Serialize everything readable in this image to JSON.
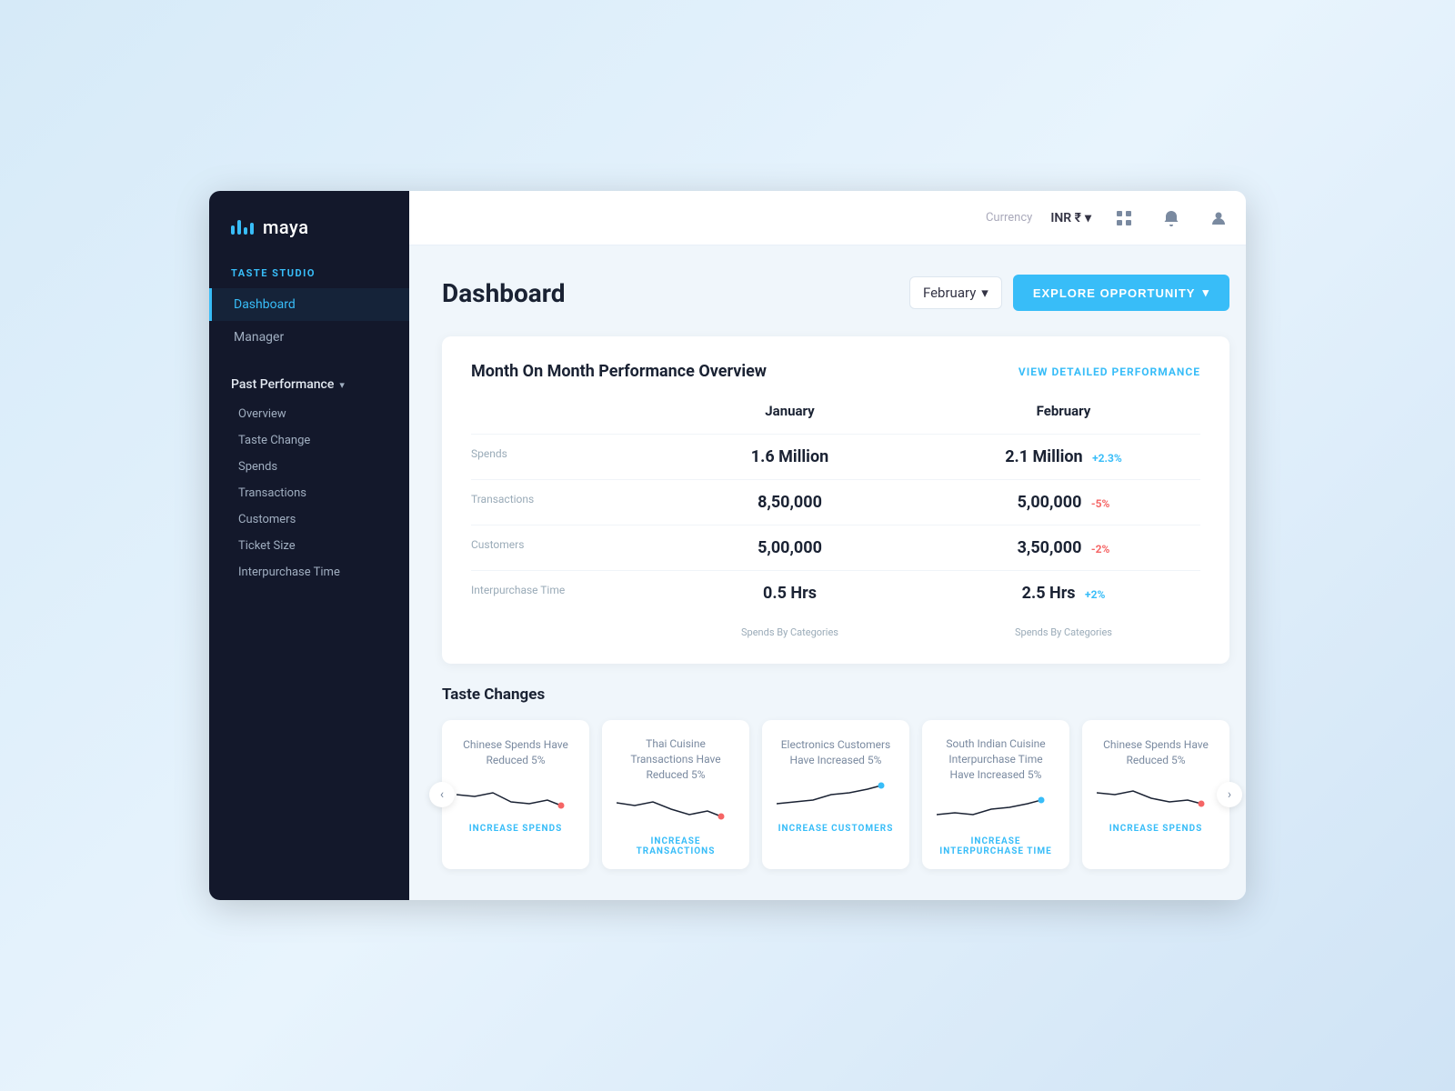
{
  "logo": {
    "text": "maya"
  },
  "sidebar": {
    "section_label": "TASTE STUDIO",
    "nav_items": [
      {
        "label": "Dashboard",
        "active": true
      },
      {
        "label": "Manager",
        "active": false
      }
    ],
    "past_performance": {
      "label": "Past Performance",
      "chevron": "▾",
      "subitems": [
        "Overview",
        "Taste Change",
        "Spends",
        "Transactions",
        "Customers",
        "Ticket Size",
        "Interpurchase Time"
      ]
    }
  },
  "topbar": {
    "currency_label": "Currency",
    "currency_value": "INR ₹",
    "currency_chevron": "▾"
  },
  "page": {
    "title": "Dashboard",
    "month_selector": "February",
    "month_chevron": "▾",
    "explore_btn": "EXPLORE OPPORTUNITY",
    "explore_chevron": "▾"
  },
  "performance": {
    "section_title": "Month On Month Performance Overview",
    "view_link": "VIEW DETAILED PERFORMANCE",
    "spends_chart_label_left": "Spends By Categories",
    "spends_chart_label_right": "Spends By Categories",
    "col_january": "January",
    "col_february": "February",
    "rows": [
      {
        "label": "Spends",
        "jan_value": "1.6 Million",
        "feb_value": "2.1 Million",
        "feb_change": "+2.3%",
        "feb_change_type": "positive"
      },
      {
        "label": "Transactions",
        "jan_value": "8,50,000",
        "feb_value": "5,00,000",
        "feb_change": "-5%",
        "feb_change_type": "negative"
      },
      {
        "label": "Customers",
        "jan_value": "5,00,000",
        "feb_value": "3,50,000",
        "feb_change": "-2%",
        "feb_change_type": "negative"
      },
      {
        "label": "Interpurchase Time",
        "jan_value": "0.5 Hrs",
        "feb_value": "2.5 Hrs",
        "feb_change": "+2%",
        "feb_change_type": "positive"
      }
    ]
  },
  "taste_changes": {
    "section_title": "Taste Changes",
    "cards": [
      {
        "title": "Chinese Spends Have Reduced 5%",
        "action": "INCREASE SPENDS",
        "dot_color": "#f56565",
        "sparkline_type": "down"
      },
      {
        "title": "Thai Cuisine Transactions Have Reduced 5%",
        "action": "INCREASE TRANSACTIONS",
        "dot_color": "#f56565",
        "sparkline_type": "down"
      },
      {
        "title": "Electronics Customers Have Increased 5%",
        "action": "INCREASE CUSTOMERS",
        "dot_color": "#38bdf8",
        "sparkline_type": "up"
      },
      {
        "title": "South Indian Cuisine Interpurchase Time Have Increased 5%",
        "action": "INCREASE INTERPURCHASE TIME",
        "dot_color": "#38bdf8",
        "sparkline_type": "up"
      },
      {
        "title": "Chinese Spends Have Reduced 5%",
        "action": "INCREASE SPENDS",
        "dot_color": "#f56565",
        "sparkline_type": "down"
      }
    ]
  }
}
